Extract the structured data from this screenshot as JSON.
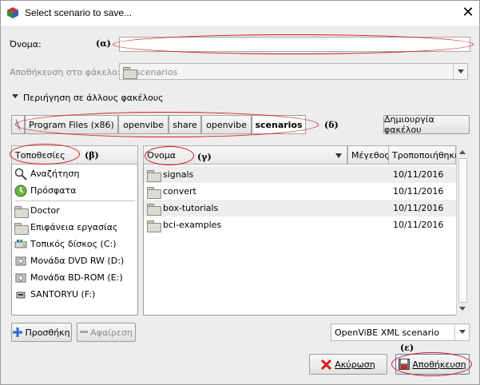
{
  "window": {
    "title": "Select scenario to save..."
  },
  "name_row": {
    "label": "Όνομα:",
    "value": "",
    "annotation": "(α)"
  },
  "save_in": {
    "label": "Αποθήκευση στο φάκελο:",
    "folder": "scenarios"
  },
  "browse": {
    "label": "Περιήγηση σε άλλους φακέλους"
  },
  "path": {
    "segments": [
      "Program Files (x86)",
      "openvibe",
      "share",
      "openvibe",
      "scenarios"
    ],
    "annotation": "(δ)",
    "create_folder_label": "Δημιουργία φακέλου"
  },
  "places": {
    "header": "Τοποθεσίες",
    "annotation": "(β)",
    "items": [
      {
        "label": "Αναζήτηση",
        "icon": "search-icon"
      },
      {
        "label": "Πρόσφατα",
        "icon": "recent-icon"
      },
      {
        "label": "Doctor",
        "icon": "folder-icon"
      },
      {
        "label": "Επιφάνεια εργασίας",
        "icon": "folder-icon"
      },
      {
        "label": "Τοπικός δίσκος (C:)",
        "icon": "drive-icon"
      },
      {
        "label": "Μονάδα DVD RW (D:)",
        "icon": "disc-icon"
      },
      {
        "label": "Μονάδα BD-ROM (E:)",
        "icon": "disc-icon"
      },
      {
        "label": "SANTORYU (F:)",
        "icon": "usb-drive-icon"
      }
    ],
    "add_label": "Προσθήκη",
    "remove_label": "Αφαίρεση"
  },
  "files": {
    "columns": {
      "name": "Όνομα",
      "size": "Μέγεθος",
      "modified": "Τροποποιήθηκε"
    },
    "annotation": "(γ)",
    "rows": [
      {
        "name": "signals",
        "modified": "10/11/2016"
      },
      {
        "name": "convert",
        "modified": "10/11/2016"
      },
      {
        "name": "box-tutorials",
        "modified": "10/11/2016"
      },
      {
        "name": "bci-examples",
        "modified": "10/11/2016"
      }
    ]
  },
  "filter": {
    "value": "OpenViBE XML scenario"
  },
  "actions": {
    "cancel_label": "Ακύρωση",
    "save_label": "Αποθήκευση",
    "annotation": "(ε)"
  },
  "colors": {
    "annotation_red": "#d21a1a",
    "active_path": "#ffffff"
  }
}
